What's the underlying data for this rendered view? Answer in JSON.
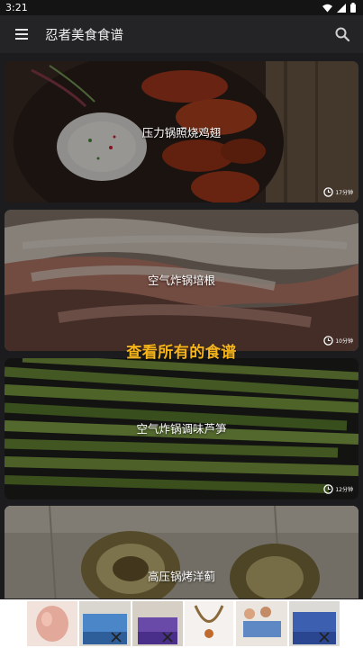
{
  "status": {
    "time": "3:21"
  },
  "app": {
    "title": "忍者美食食谱"
  },
  "recipes": [
    {
      "name": "压力锅照烧鸡翅",
      "time": "17分钟"
    },
    {
      "name": "空气炸锅培根",
      "time": "10分钟"
    },
    {
      "name": "空气炸锅调味芦笋",
      "time": "12分钟"
    },
    {
      "name": "高压锅烤洋蓟",
      "time": ""
    }
  ],
  "view_all_label": "查看所有的食谱",
  "colors": {
    "accent": "#f5b41b",
    "background": "#1c1c1e",
    "appbar": "#242426"
  },
  "icons": [
    "menu-icon",
    "search-icon",
    "clock-icon",
    "close-icon",
    "wifi-icon",
    "signal-icon",
    "battery-icon"
  ]
}
